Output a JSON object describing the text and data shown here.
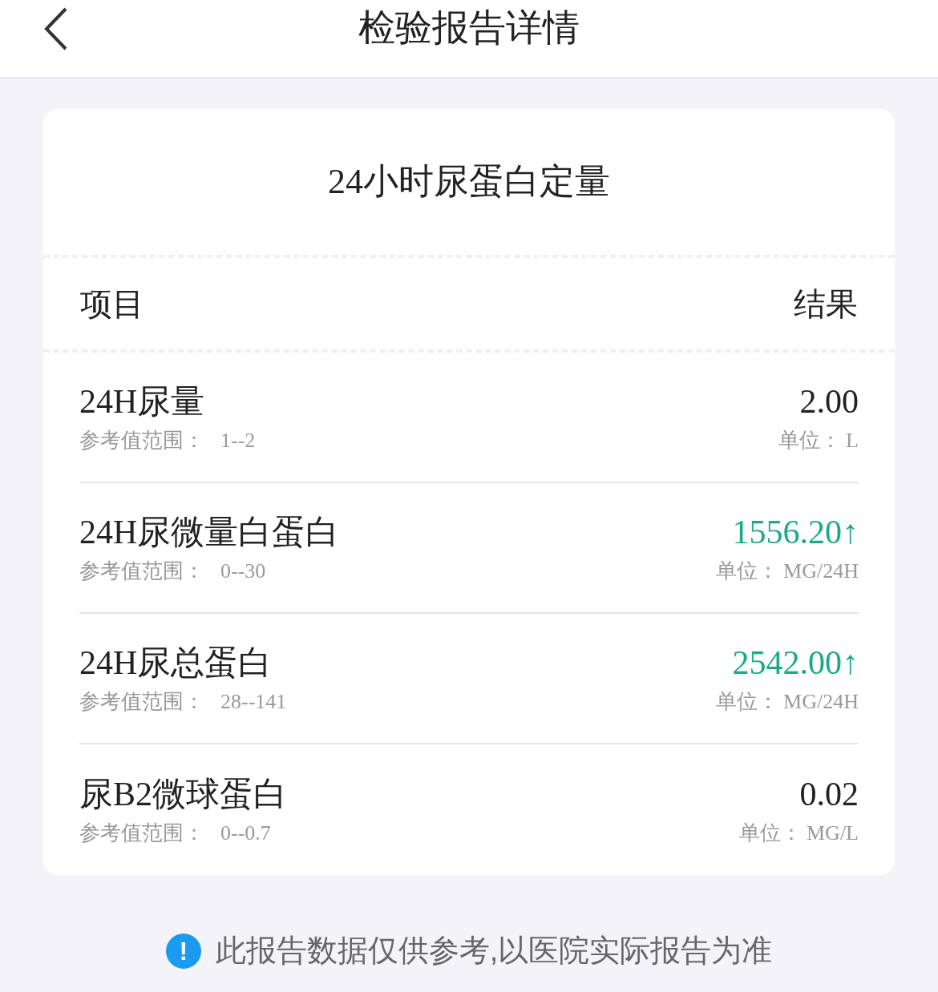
{
  "header": {
    "title": "检验报告详情"
  },
  "card": {
    "title": "24小时尿蛋白定量",
    "columns": [
      "项目",
      "结果"
    ],
    "rows": [
      {
        "name": "24H尿量",
        "ref_label": "参考值范围：",
        "ref": "1--2",
        "value": "2.00",
        "abnormal": false,
        "unit_label": "单位：",
        "unit": "L"
      },
      {
        "name": "24H尿微量白蛋白",
        "ref_label": "参考值范围：",
        "ref": "0--30",
        "value": "1556.20↑",
        "abnormal": true,
        "unit_label": "单位：",
        "unit": "MG/24H"
      },
      {
        "name": "24H尿总蛋白",
        "ref_label": "参考值范围：",
        "ref": "28--141",
        "value": "2542.00↑",
        "abnormal": true,
        "unit_label": "单位：",
        "unit": "MG/24H"
      },
      {
        "name": "尿B2微球蛋白",
        "ref_label": "参考值范围：",
        "ref": "0--0.7",
        "value": "0.02",
        "abnormal": false,
        "unit_label": "单位：",
        "unit": "MG/L"
      }
    ]
  },
  "notice": {
    "icon": "!",
    "text": "此报告数据仅供参考,以医院实际报告为准"
  }
}
